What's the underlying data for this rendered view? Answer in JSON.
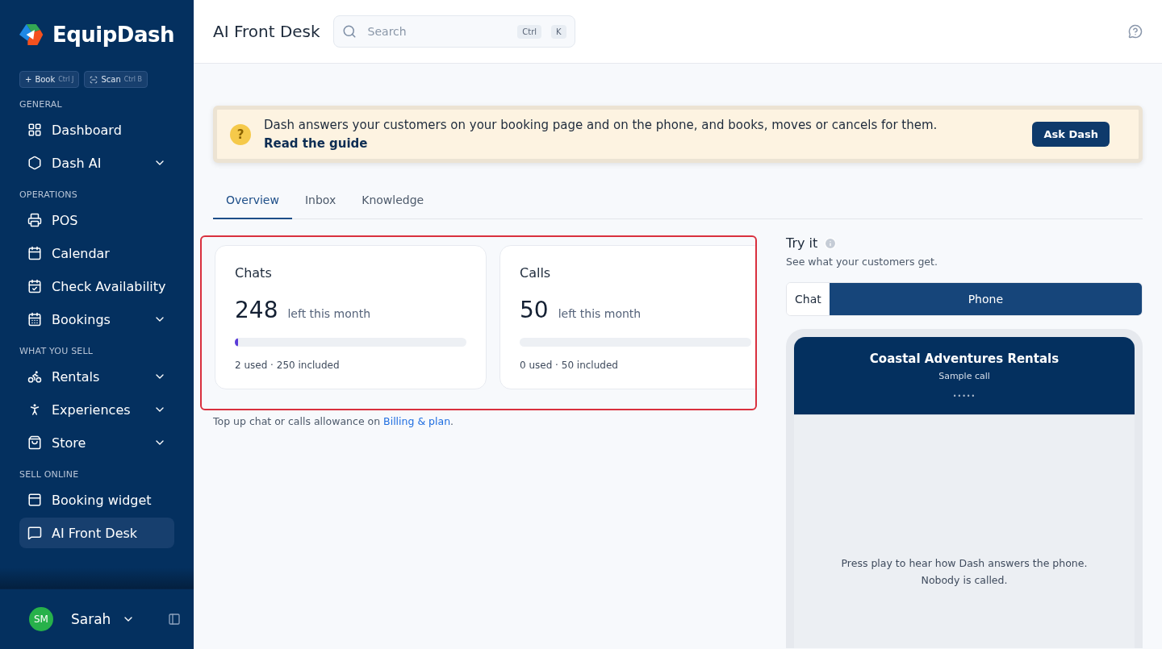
{
  "sidebar": {
    "brand": "EquipDash",
    "quick_actions": [
      {
        "label": "Book",
        "sign": "+",
        "shortcut": "Ctrl J"
      },
      {
        "label": "Scan",
        "shortcut": "Ctrl B"
      }
    ],
    "sections": [
      {
        "title": "GENERAL",
        "items": [
          {
            "label": "Dashboard",
            "expandable": false,
            "selected": false
          },
          {
            "label": "Dash AI",
            "expandable": true,
            "selected": false
          }
        ]
      },
      {
        "title": "OPERATIONS",
        "items": [
          {
            "label": "POS",
            "expandable": false,
            "selected": false
          },
          {
            "label": "Calendar",
            "expandable": false,
            "selected": false
          },
          {
            "label": "Check Availability",
            "expandable": false,
            "selected": false
          },
          {
            "label": "Bookings",
            "expandable": true,
            "selected": false
          }
        ]
      },
      {
        "title": "WHAT YOU SELL",
        "items": [
          {
            "label": "Rentals",
            "expandable": true,
            "selected": false
          },
          {
            "label": "Experiences",
            "expandable": true,
            "selected": false
          },
          {
            "label": "Store",
            "expandable": true,
            "selected": false
          }
        ]
      },
      {
        "title": "SELL ONLINE",
        "items": [
          {
            "label": "Booking widget",
            "expandable": false,
            "selected": false
          },
          {
            "label": "AI Front Desk",
            "expandable": false,
            "selected": true
          }
        ]
      }
    ],
    "user": {
      "initials": "SM",
      "name": "Sarah"
    }
  },
  "header": {
    "title": "AI Front Desk",
    "search": {
      "placeholder": "Search",
      "keys": [
        "Ctrl",
        "K"
      ]
    }
  },
  "banner": {
    "sign": "?",
    "text": "Dash answers your customers on your booking page and on the phone, and books, moves or cancels for them.",
    "link": "Read the guide",
    "button": "Ask Dash"
  },
  "tabs": [
    {
      "label": "Overview",
      "selected": true
    },
    {
      "label": "Inbox",
      "selected": false
    },
    {
      "label": "Knowledge",
      "selected": false
    }
  ],
  "usage_cards": [
    {
      "title": "Chats",
      "count": "248",
      "count_label": "left this month",
      "level": 0.008,
      "detail": "2 used · 250 included"
    },
    {
      "title": "Calls",
      "count": "50",
      "count_label": "left this month",
      "level": 0,
      "detail": "0 used · 50 included"
    }
  ],
  "usage_note": {
    "text": "Top up chat or calls allowance on ",
    "link": "Billing & plan",
    "end": "."
  },
  "try_it": {
    "title": "Try it",
    "subtitle": "See what your customers get.",
    "modes": [
      {
        "label": "Chat",
        "selected": false
      },
      {
        "label": "Phone",
        "selected": true
      }
    ],
    "phone": {
      "business": "Coastal Adventures Rentals",
      "caption": "Sample call",
      "dots": "•••••",
      "message": "Press play to hear how Dash answers the phone.",
      "note": "Nobody is called."
    }
  }
}
